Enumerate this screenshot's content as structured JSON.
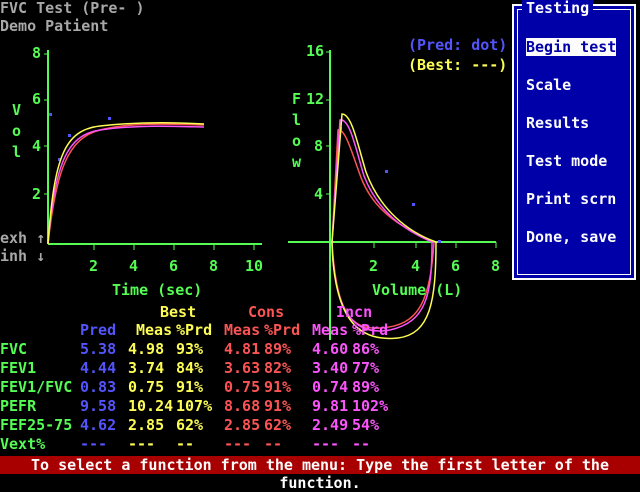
{
  "header": {
    "title": "FVC Test (Pre- )",
    "patient": "Demo Patient"
  },
  "left_chart": {
    "ylabel": [
      "V",
      "o",
      "l"
    ],
    "xlabel": "Time (sec)",
    "xticks": [
      "2",
      "4",
      "6",
      "8",
      "10"
    ],
    "yticks": [
      "8",
      "6",
      "4",
      "2"
    ],
    "exh": "exh ↑",
    "inh": "inh ↓"
  },
  "right_chart": {
    "ylabel": [
      "F",
      "l",
      "o",
      "w"
    ],
    "xlabel": "Volume (L)",
    "xticks": [
      "2",
      "4",
      "6",
      "8"
    ],
    "yticks": [
      "16",
      "12",
      "8",
      "4"
    ],
    "legend_pred": "(Pred: dot)",
    "legend_best": "(Best: ---)"
  },
  "menu": {
    "title": "Testing",
    "items": [
      "Begin test",
      "Scale",
      "Results",
      "Test mode",
      "Print scrn",
      "Done, save"
    ]
  },
  "table": {
    "group_best": "Best",
    "group_cons": "Cons",
    "group_incn": "Incn",
    "col_pred": "Pred",
    "col_meas": "Meas",
    "col_prd": "%Prd",
    "rows": [
      {
        "name": "FVC",
        "pred": "5.38",
        "best_m": "4.98",
        "best_p": "93%",
        "cons_m": "4.81",
        "cons_p": "89%",
        "incn_m": "4.60",
        "incn_p": "86%"
      },
      {
        "name": "FEV1",
        "pred": "4.44",
        "best_m": "3.74",
        "best_p": "84%",
        "cons_m": "3.63",
        "cons_p": "82%",
        "incn_m": "3.40",
        "incn_p": "77%"
      },
      {
        "name": "FEV1/FVC",
        "pred": "0.83",
        "best_m": "0.75",
        "best_p": "91%",
        "cons_m": "0.75",
        "cons_p": "91%",
        "incn_m": "0.74",
        "incn_p": "89%"
      },
      {
        "name": "PEFR",
        "pred": "9.58",
        "best_m": "10.24",
        "best_p": "107%",
        "cons_m": "8.68",
        "cons_p": "91%",
        "incn_m": "9.81",
        "incn_p": "102%"
      },
      {
        "name": "FEF25-75",
        "pred": "4.62",
        "best_m": "2.85",
        "best_p": "62%",
        "cons_m": "2.85",
        "cons_p": "62%",
        "incn_m": "2.49",
        "incn_p": "54%"
      },
      {
        "name": "Vext%",
        "pred": "---",
        "best_m": "---",
        "best_p": "--",
        "cons_m": "---",
        "cons_p": "--",
        "incn_m": "---",
        "incn_p": "--"
      }
    ]
  },
  "status": "To select a function from the menu: Type the first letter of the function."
}
